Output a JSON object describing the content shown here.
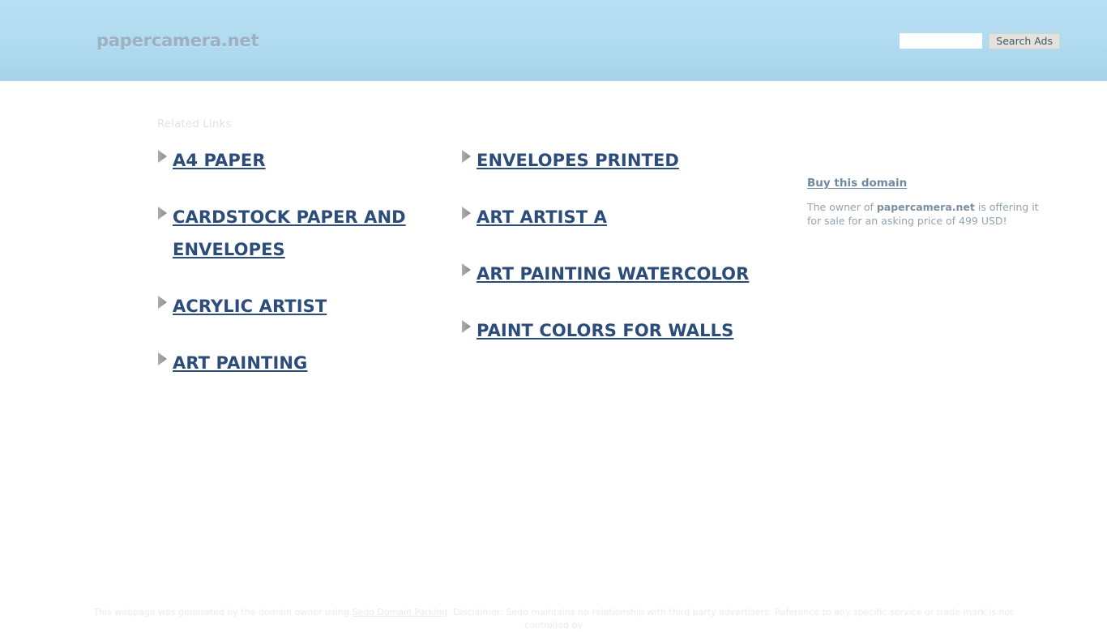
{
  "header": {
    "site_title": "papercamera.net",
    "search": {
      "value": "",
      "placeholder": "",
      "button_label": "Search Ads"
    }
  },
  "main": {
    "related_links_label": "Related Links",
    "links_left": [
      {
        "label": "A4 PAPER"
      },
      {
        "label": "CARDSTOCK PAPER AND ENVELOPES"
      },
      {
        "label": "ACRYLIC ARTIST"
      },
      {
        "label": "ART PAINTING"
      }
    ],
    "links_right": [
      {
        "label": "ENVELOPES PRINTED"
      },
      {
        "label": "ART ARTIST A"
      },
      {
        "label": "ART PAINTING WATERCOLOR"
      },
      {
        "label": "PAINT COLORS FOR WALLS"
      }
    ]
  },
  "sidebar": {
    "buy_link_label": "Buy this domain",
    "offer_prefix": "The owner of ",
    "offer_domain": "papercamera.net",
    "offer_suffix": " is offering it for sale for an asking price of 499 USD!"
  },
  "footer": {
    "text_before_link": "This webpage was generated by the domain owner using ",
    "link_label": "Sedo Domain Parking",
    "text_after_link": ". Disclaimer: Sedo maintains no relationship with third party advertisers. Reference to any specific service or trade mark is not controlled by"
  },
  "colors": {
    "header_gradient_top": "#b8dff3",
    "header_gradient_bottom": "#a7d2e9",
    "link_navy": "#2c4c79",
    "buy_link_slate": "#6f8aa0",
    "body_slate": "#93a3b1",
    "bullet_gray": "#9a9a9a",
    "footer_gray": "#ebebeb"
  }
}
